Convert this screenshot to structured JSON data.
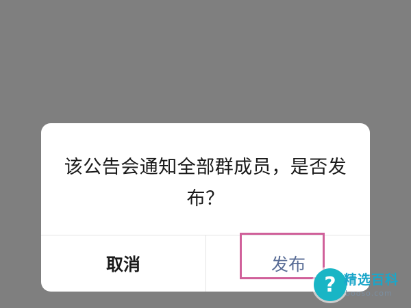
{
  "dialog": {
    "message": "该公告会通知全部群成员，是否发布？",
    "cancel_label": "取消",
    "publish_label": "发布"
  },
  "watermark": {
    "icon_glyph": "?",
    "title": "精选百科",
    "site": "booso.com"
  },
  "colors": {
    "overlay": "#7f7f7f",
    "dialog_bg": "#ffffff",
    "primary_text": "#1a1a1a",
    "publish_text": "#576b95",
    "highlight_border": "#d0609a",
    "watermark_accent": "#19b5c5"
  }
}
